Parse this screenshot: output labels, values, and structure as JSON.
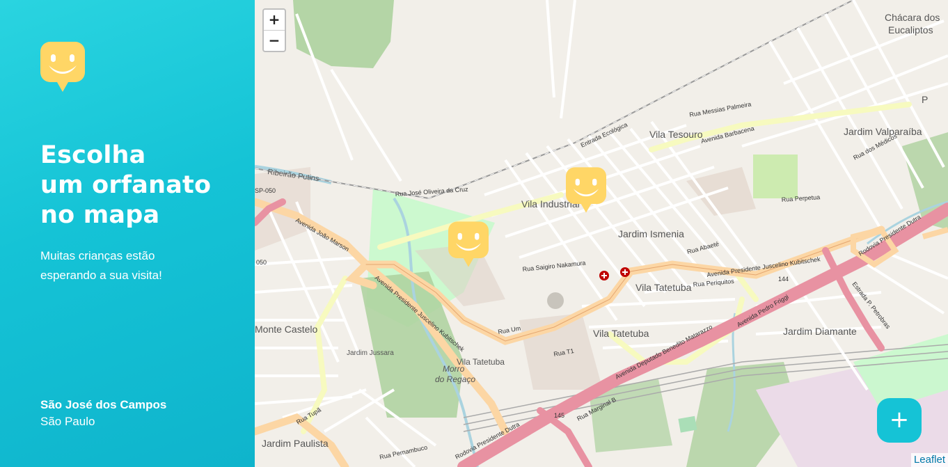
{
  "sidebar": {
    "title_line1": "Escolha",
    "title_line2": "um orfanato",
    "title_line3": "no mapa",
    "subtitle": "Muitas crianças estão esperando a sua visita!",
    "city": "São José dos Campos",
    "state": "São Paulo"
  },
  "map": {
    "zoom_in": "+",
    "zoom_out": "−",
    "attribution": "Leaflet",
    "add_button": "+",
    "labels": {
      "chacara": "Chácara dos",
      "chacara2": "Eucaliptos",
      "vila_tesouro": "Vila Tesouro",
      "jardim_valparaiba": "Jardim Valparaíba",
      "vila_industrial": "Vila Industrial",
      "jardim_ismenia": "Jardim Ismenia",
      "vila_tatetuba": "Vila Tatetuba",
      "vila_tatetuba2": "Vila Tatetuba",
      "vila_tatetuba3": "Vila Tatetuba",
      "jardim_diamante": "Jardim Diamante",
      "monte_castelo": "Monte Castelo",
      "jardim_jussara": "Jardim Jussara",
      "morro": "Morro",
      "do_regaco": "do Regaço",
      "jardim_paulista": "Jardim Paulista",
      "ribeirao": "Ribeirão Putins",
      "sp050": "SP-050",
      "s050": "050",
      "n144": "144",
      "n145": "145",
      "av_barbacena": "Avenida Barbacena",
      "av_jk": "Avenida Presidente Juscelino Kubitschek",
      "av_jk2": "Avenida Presidente Juscelino Kubitschek",
      "av_joao_marson": "Avenida João Marson",
      "rod_dutra": "Rodovia Presidente Dutra",
      "rod_dutra2": "Rodovia Presidente Dutra",
      "av_pedro_friggi": "Avenida Pedro Friggi",
      "av_dep": "Avenida Deputado Benedito Matarazzo",
      "rua_marginal": "Rua Marginal B",
      "rua_oliveira": "Rua José Oliveira da Cruz",
      "rua_messias": "Rua Messias Palmeira",
      "estrada_eco": "Entrada Ecológica",
      "rua_saigiro": "Rua Saigiro Nakamura",
      "rua_periquitos": "Rua Periquitos",
      "rua_tupa": "Rua Tupã",
      "rua_pernambuco": "Rua Pernambuco",
      "rua_um": "Rua Um",
      "rua_t1": "Rua T1",
      "rua_perpetua": "Rua Perpetua",
      "rua_abaete": "Rua Abaeté",
      "rua_medicos": "Rua dos Médicos",
      "estrada_petrobras": "Estrada P. Petrobras",
      "p": "P"
    }
  },
  "colors": {
    "accent": "#15c3d6",
    "marker": "#ffd666",
    "motorway": "#e892a2",
    "primary": "#fcd6a4",
    "secondary": "#f7fabf"
  }
}
